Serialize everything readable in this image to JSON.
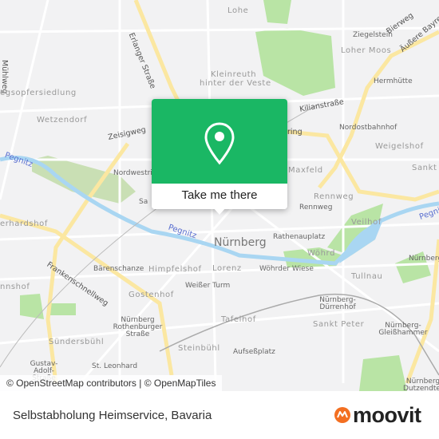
{
  "colors": {
    "accent": "#1ab764",
    "brand_orange": "#f36f21",
    "park": "#b5e3a0",
    "water": "#a9d6f2",
    "major_road": "#fbe7a1"
  },
  "map": {
    "labels": [
      "Lohe",
      "Erlanger Straße",
      "Mühlweg",
      "Kleinreuth",
      "hinter der Veste",
      "Ziegelstein",
      "Loher Moos",
      "Bierweg",
      "Äußere Bayreuther Straße",
      "Hermhütte",
      "egsopfersiedlung",
      "Wetzendorf",
      "Zeisigweg",
      "Kilianstraße",
      "Nordostbahnhof",
      "Weigelshof",
      "Sankt",
      "Pegnitz",
      "Nordwestring",
      "Maxfeld",
      "Rennweg",
      "Rennweg",
      "Veilhof",
      "erhardshof",
      "Pegnitz",
      "Nürnberg",
      "Rathenauplatz",
      "Pegnitz",
      "Bärenschanze",
      "Himpfelshof",
      "Lorenz",
      "Wöhrder Wiese",
      "Wöhrd",
      "Tullnau",
      "nnshof",
      "Frankenschnellweg",
      "Weißer Turm",
      "Gostenhof",
      "Nürnberg-Dürrenhof",
      "Nürnberg Rothenburger Straße",
      "Tafelhof",
      "Sankt Peter",
      "Nürnberg-Gleißhammer",
      "Sündersbühl",
      "Steinbühl",
      "Aufseßplatz",
      "Gustav-Adolf-Straße",
      "St. Leonhard",
      "Nürnberg",
      "Nürnberg Dutzendteich",
      "Sa",
      "ring"
    ],
    "attribution": "© OpenStreetMap contributors | © OpenMapTiles"
  },
  "popup": {
    "icon": "map-pin-icon",
    "button_label": "Take me there"
  },
  "footer": {
    "title": "Selbstabholung Heimservice, Bavaria",
    "logo_text": "moovit"
  }
}
